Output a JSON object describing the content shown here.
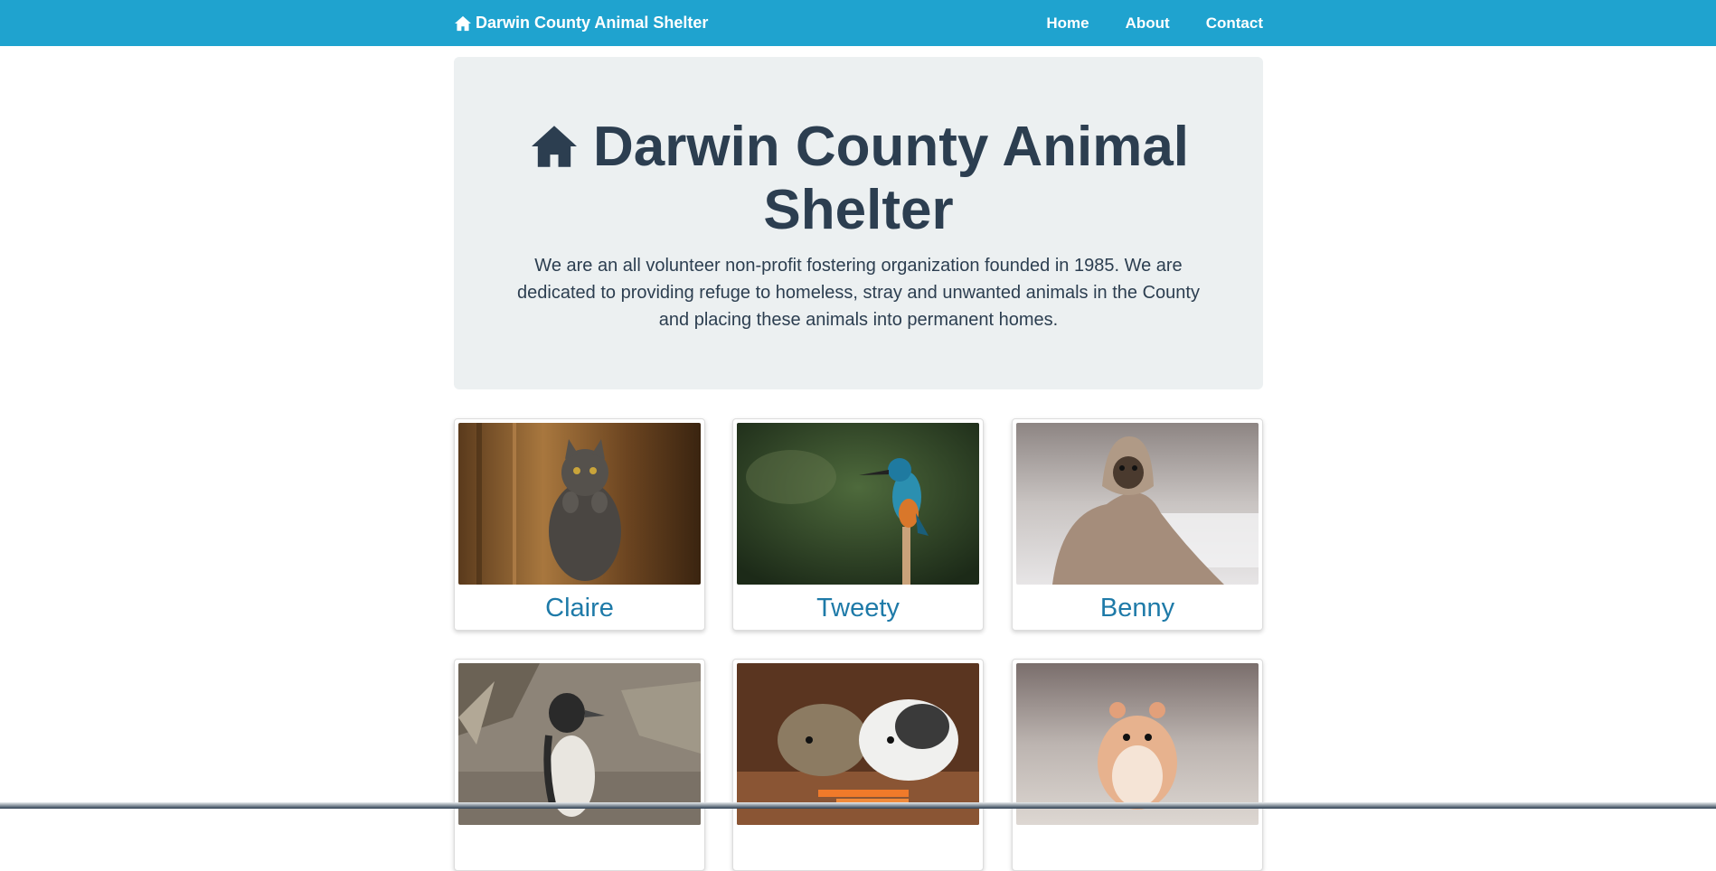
{
  "navbar": {
    "brand": "Darwin County Animal Shelter",
    "brand_icon": "home-icon",
    "links": [
      {
        "label": "Home"
      },
      {
        "label": "About"
      },
      {
        "label": "Contact"
      }
    ],
    "color": "#1fa3cf"
  },
  "hero": {
    "icon": "home-icon",
    "title": "Darwin County Animal Shelter",
    "description": "We are an all volunteer non-profit fostering organization founded in 1985. We are dedicated to providing refuge to homeless, stray and unwanted animals in the County and placing these animals into permanent homes."
  },
  "animals": [
    {
      "name": "Claire",
      "photo": "gray-cat-photo"
    },
    {
      "name": "Tweety",
      "photo": "kingfisher-photo"
    },
    {
      "name": "Benny",
      "photo": "pug-blanket-photo"
    },
    {
      "name": "",
      "photo": "penguin-photo"
    },
    {
      "name": "",
      "photo": "guinea-pigs-photo"
    },
    {
      "name": "",
      "photo": "hamster-photo"
    }
  ],
  "colors": {
    "accent": "#1fa3cf",
    "text_dark": "#2c3e50",
    "card_name": "#1e7aa8",
    "hero_bg": "#ecf0f1"
  }
}
